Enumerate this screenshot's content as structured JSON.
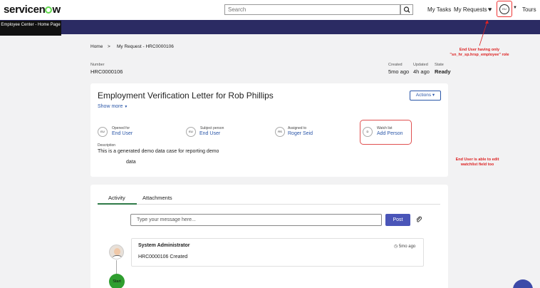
{
  "header": {
    "logo_prefix": "servicen",
    "logo_suffix": "w",
    "search_placeholder": "Search",
    "my_tasks": "My Tasks",
    "my_requests": "My Requests",
    "avatar_initials": "EU",
    "tours": "Tours"
  },
  "tooltip": "Employee Center - Home Page",
  "breadcrumb": {
    "home": "Home",
    "separator": ">",
    "current": "My Request - HRC0000106"
  },
  "record": {
    "number_label": "Number",
    "number": "HRC0000106",
    "created_label": "Created",
    "created": "5mo ago",
    "updated_label": "Updated",
    "updated": "4h ago",
    "state_label": "State",
    "state": "Ready"
  },
  "case": {
    "title": "Employment Verification Letter for Rob Phillips",
    "show_more": "Show more",
    "actions": "Actions ▾",
    "opened_for_label": "Opened for",
    "opened_for_initials": "EU",
    "opened_for": "End User",
    "subject_label": "Subject person",
    "subject_initials": "EU",
    "subject": "End User",
    "assigned_label": "Assigned to",
    "assigned_initials": "RS",
    "assigned": "Roger Seid",
    "watch_label": "Watch list",
    "watch_initials": "D",
    "watch": "Add Person",
    "description_label": "Description",
    "description_line1": "This is a generated demo data case for reporting demo",
    "description_line2": "data"
  },
  "annotations": {
    "top_note": "End User having only \"sn_hr_sp.hrsp_employee\" role",
    "side_note": "End User is able to edit watchlist field too"
  },
  "activity": {
    "tab_activity": "Activity",
    "tab_attachments": "Attachments",
    "input_placeholder": "Type your message here...",
    "post": "Post",
    "entry_author": "System Administrator",
    "entry_time": "5mo ago",
    "entry_text": "HRC0000106 Created",
    "start": "Start"
  },
  "colors": {
    "banner": "#2b2b63",
    "link": "#2a56a8",
    "post_button": "#4a55b8",
    "annotation": "#dd2222"
  }
}
